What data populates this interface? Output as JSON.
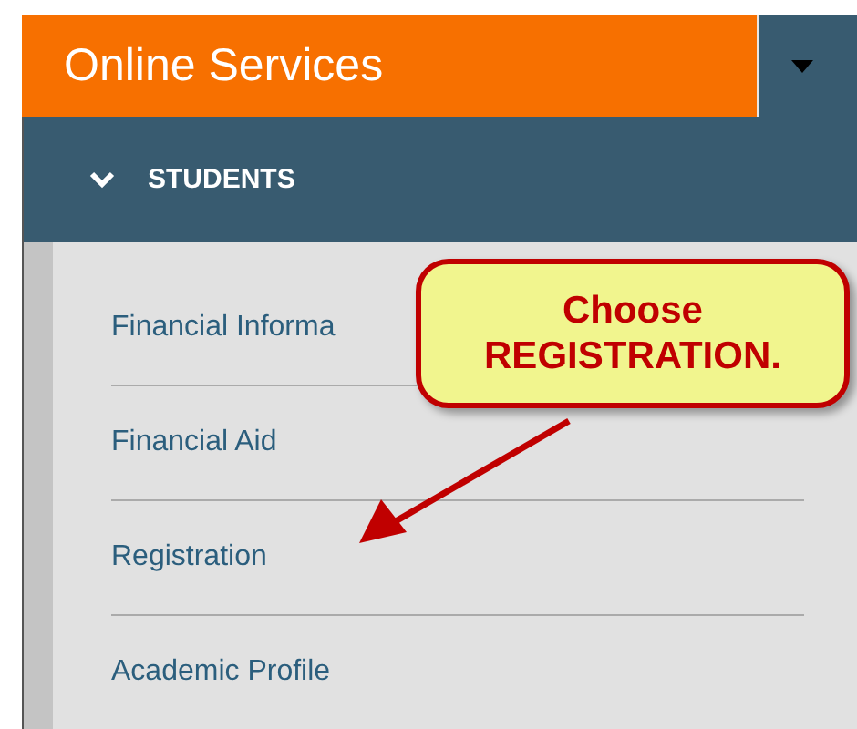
{
  "header": {
    "title": "Online Services"
  },
  "section": {
    "label": "STUDENTS",
    "expanded": true
  },
  "menu_items": [
    {
      "label": "Financial Informa"
    },
    {
      "label": "Financial Aid"
    },
    {
      "label": "Registration"
    },
    {
      "label": "Academic Profile"
    }
  ],
  "callout": {
    "text": "Choose REGISTRATION."
  }
}
